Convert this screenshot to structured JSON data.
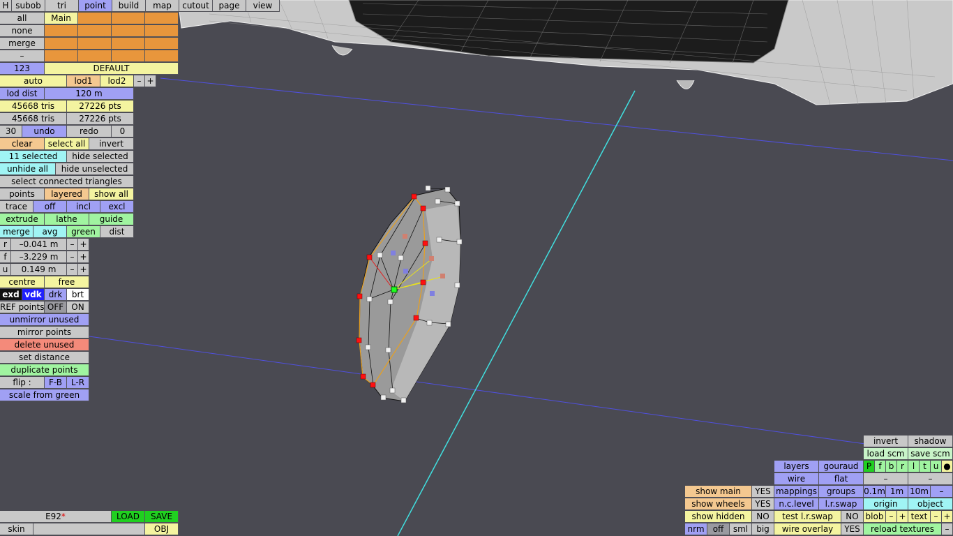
{
  "colors": {
    "background": "#4a4a52",
    "wire": "#e8e8e8",
    "axis_cyan": "#40e0e0",
    "axis_blue": "#5050e0",
    "selected": "#ff1010",
    "green_point": "#20ff20",
    "edge_orange": "#e8a020"
  },
  "top_tabs": [
    "H",
    "subob",
    "tri",
    "point",
    "build",
    "map",
    "cutout",
    "page",
    "view"
  ],
  "left": {
    "all": "all",
    "none": "none",
    "merge": "merge",
    "dash": "–",
    "num123": "123",
    "main": "Main",
    "default": "DEFAULT",
    "auto": "auto",
    "lod1": "lod1",
    "lod2": "lod2",
    "minus": "–",
    "plus": "+",
    "lod_dist": "lod dist",
    "lod_value": "120 m",
    "tris1": "45668 tris",
    "pts1": "27226 pts",
    "tris2": "45668 tris",
    "pts2": "27226 pts",
    "n30": "30",
    "undo": "undo",
    "redo": "redo",
    "n0": "0",
    "clear": "clear",
    "select_all": "select all",
    "invert": "invert",
    "selected": "11 selected",
    "hide_selected": "hide selected",
    "unhide_all": "unhide all",
    "hide_unselected": "hide unselected",
    "select_connected": "select connected triangles",
    "points": "points",
    "layered": "layered",
    "show_all": "show all",
    "trace": "trace",
    "off": "off",
    "incl": "incl",
    "excl": "excl",
    "extrude": "extrude",
    "lathe": "lathe",
    "guide": "guide",
    "merge2": "merge",
    "avg": "avg",
    "green": "green",
    "dist": "dist",
    "r": "r",
    "r_val": "–0.041 m",
    "f": "f",
    "f_val": "–3.229 m",
    "u": "u",
    "u_val": "0.149 m",
    "centre": "centre",
    "free": "free",
    "exd": "exd",
    "vdk": "vdk",
    "drk": "drk",
    "brt": "brt",
    "ref_points": "REF points",
    "ref_off": "OFF",
    "ref_on": "ON",
    "unmirror_unused": "unmirror unused",
    "mirror_points": "mirror points",
    "delete_unused": "delete unused",
    "set_distance": "set distance",
    "duplicate_points": "duplicate points",
    "flip": "flip :",
    "fb": "F-B",
    "lr": "L-R",
    "scale_from_green": "scale from green"
  },
  "bottom_left": {
    "name": "E92",
    "star": "*",
    "load": "LOAD",
    "save": "SAVE",
    "skin": "skin",
    "obj": "OBJ"
  },
  "right": {
    "invert": "invert",
    "shadow": "shadow",
    "load_scm": "load scm",
    "save_scm": "save scm",
    "layers": "layers",
    "gouraud": "gouraud",
    "pfbrltu": [
      "P",
      "f",
      "b",
      "r",
      "l",
      "t",
      "u"
    ],
    "dot": "●",
    "wire": "wire",
    "flat": "flat",
    "dash1": "–",
    "dash2": "–",
    "mappings": "mappings",
    "groups": "groups",
    "m01": "0.1m",
    "m1": "1m",
    "m10": "10m",
    "mdash": "–",
    "show_main": "show main",
    "yes1": "YES",
    "nclevel": "n.c.level",
    "lrswap": "l.r.swap",
    "origin": "origin",
    "object": "object",
    "show_wheels": "show wheels",
    "yes2": "YES",
    "test_lr": "test l.r.swap",
    "no2": "NO",
    "blob": "blob",
    "text": "text",
    "pm_minus": "–",
    "pm_plus": "+",
    "show_hidden": "show hidden",
    "no1": "NO",
    "wire_overlay": "wire overlay",
    "yes3": "YES",
    "reload_textures": "reload textures",
    "nrm": "nrm",
    "off": "off",
    "sml": "sml",
    "big": "big"
  }
}
